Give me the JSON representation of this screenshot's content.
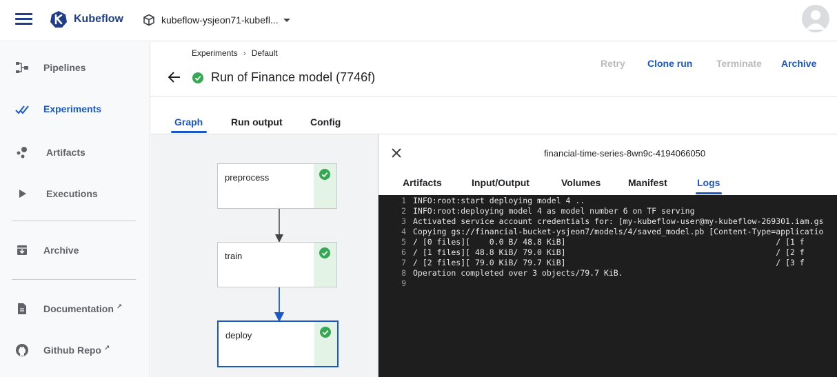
{
  "topbar": {
    "brand": "Kubeflow",
    "namespace": "kubeflow-ysjeon71-kubefl..."
  },
  "sidebar": {
    "items": [
      {
        "label": "Pipelines",
        "icon": "pipelines-icon"
      },
      {
        "label": "Experiments",
        "icon": "experiments-icon",
        "active": true
      },
      {
        "label": "Artifacts",
        "icon": "artifacts-icon"
      },
      {
        "label": "Executions",
        "icon": "play-icon"
      },
      {
        "label": "Archive",
        "icon": "archive-icon"
      },
      {
        "label": "Documentation",
        "icon": "document-icon",
        "external": true
      },
      {
        "label": "Github Repo",
        "icon": "github-icon",
        "external": true
      }
    ]
  },
  "header": {
    "breadcrumbs": [
      "Experiments",
      "Default"
    ],
    "title": "Run of Finance model (7746f)",
    "actions": {
      "retry": "Retry",
      "clone": "Clone run",
      "terminate": "Terminate",
      "archive": "Archive"
    }
  },
  "tabs": [
    "Graph",
    "Run output",
    "Config"
  ],
  "graph": {
    "nodes": [
      {
        "name": "preprocess",
        "status": "succeeded"
      },
      {
        "name": "train",
        "status": "succeeded"
      },
      {
        "name": "deploy",
        "status": "succeeded",
        "selected": true
      }
    ]
  },
  "panel": {
    "pod_name": "financial-time-series-8wn9c-4194066050",
    "tabs": [
      "Artifacts",
      "Input/Output",
      "Volumes",
      "Manifest",
      "Logs"
    ],
    "active_tab": "Logs",
    "logs": [
      {
        "n": "1",
        "text": "INFO:root:start deploying model 4 .."
      },
      {
        "n": "2",
        "text": "INFO:root:deploying model 4 as model number 6 on TF serving"
      },
      {
        "n": "3",
        "text": "Activated service account credentials for: [my-kubeflow-user@my-kubeflow-269301.iam.gs"
      },
      {
        "n": "4",
        "text": "Copying gs://financial-bucket-ysjeon7/models/4/saved_model.pb [Content-Type=applicatio"
      },
      {
        "n": "5",
        "text": "/ [0 files][    0.0 B/ 48.8 KiB]                                            / [1 f"
      },
      {
        "n": "6",
        "text": "/ [1 files][ 48.8 KiB/ 79.0 KiB]                                            / [2 f"
      },
      {
        "n": "7",
        "text": "/ [2 files][ 79.0 KiB/ 79.7 KiB]                                            / [3 f"
      },
      {
        "n": "8",
        "text": "Operation completed over 3 objects/79.7 KiB."
      },
      {
        "n": "9",
        "text": ""
      }
    ]
  },
  "colors": {
    "accent": "#1a57c8",
    "success": "#34a853",
    "brand": "#1f3d8a"
  }
}
